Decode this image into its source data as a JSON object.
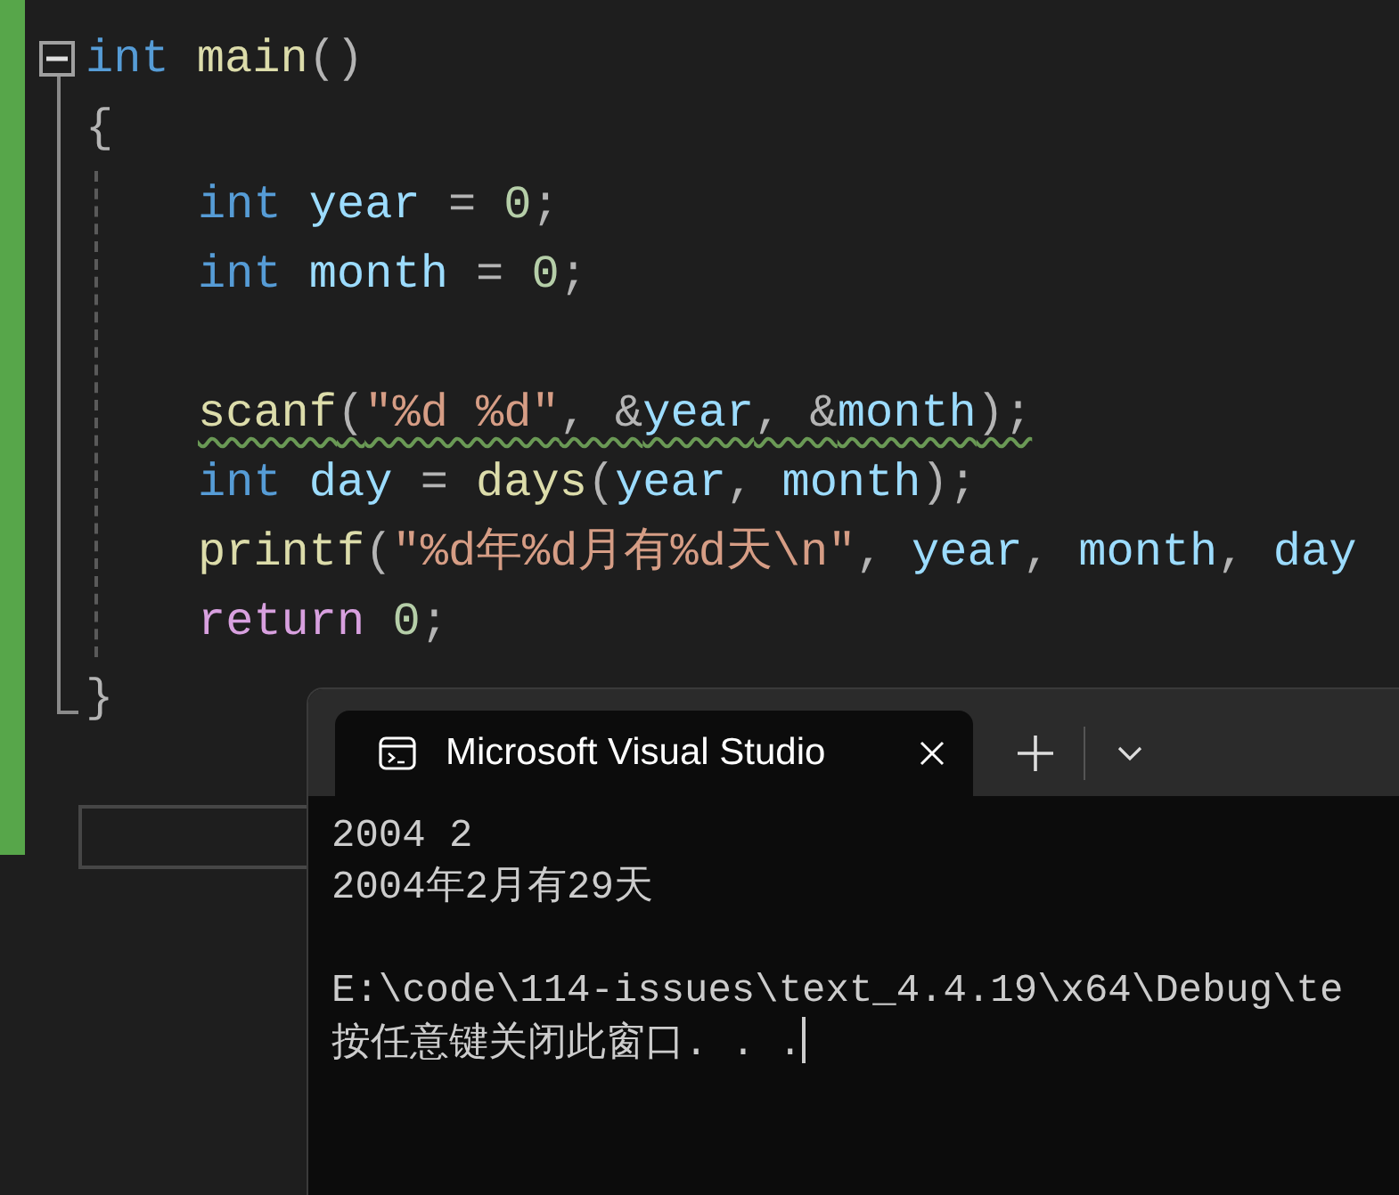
{
  "editor": {
    "lines": [
      {
        "tokens": [
          {
            "kind": "keyword",
            "text": "int"
          },
          {
            "kind": "function",
            "text": "main"
          },
          {
            "kind": "punct",
            "text": "()"
          }
        ]
      },
      {
        "tokens": [
          {
            "kind": "punct",
            "text": "{"
          }
        ],
        "children": [
          {
            "lines": [
              {
                "tokens": [
                  {
                    "kind": "keyword",
                    "text": "int"
                  },
                  {
                    "kind": "variable",
                    "text": "year"
                  },
                  {
                    "kind": "punct",
                    "text": "="
                  },
                  {
                    "kind": "number",
                    "text": "0"
                  },
                  {
                    "kind": "punct",
                    "text": ";"
                  }
                ],
                "warning": false
              },
              {
                "tokens": [
                  {
                    "kind": "keyword",
                    "text": "int"
                  },
                  {
                    "kind": "variable",
                    "text": "month"
                  },
                  {
                    "kind": "punct",
                    "text": "="
                  },
                  {
                    "kind": "number",
                    "text": "0"
                  },
                  {
                    "kind": "punct",
                    "text": ";"
                  }
                ],
                "warning": false
              }
            ]
          },
          {
            "lines": [
              {
                "tokens": [
                  {
                    "kind": "function",
                    "text": "scanf"
                  },
                  {
                    "kind": "punct",
                    "text": "("
                  },
                  {
                    "kind": "string",
                    "text": "\"%d %d\""
                  },
                  {
                    "kind": "punct",
                    "text": ", &"
                  },
                  {
                    "kind": "variable",
                    "text": "year"
                  },
                  {
                    "kind": "punct",
                    "text": ", &"
                  },
                  {
                    "kind": "variable",
                    "text": "month"
                  },
                  {
                    "kind": "punct",
                    "text": ");"
                  }
                ],
                "warning": true
              },
              {
                "tokens": [
                  {
                    "kind": "keyword",
                    "text": "int"
                  },
                  {
                    "kind": "variable",
                    "text": "day"
                  },
                  {
                    "kind": "punct",
                    "text": "="
                  },
                  {
                    "kind": "function",
                    "text": "days"
                  },
                  {
                    "kind": "punct",
                    "text": "("
                  },
                  {
                    "kind": "variable",
                    "text": "year"
                  },
                  {
                    "kind": "punct",
                    "text": ", "
                  },
                  {
                    "kind": "variable",
                    "text": "month"
                  },
                  {
                    "kind": "punct",
                    "text": ");"
                  }
                ],
                "warning": false
              },
              {
                "tokens": [
                  {
                    "kind": "function",
                    "text": "printf"
                  },
                  {
                    "kind": "punct",
                    "text": "("
                  },
                  {
                    "kind": "string",
                    "text": "\"%d年%d月有%d天\\n\""
                  },
                  {
                    "kind": "punct",
                    "text": ", "
                  },
                  {
                    "kind": "variable",
                    "text": "year"
                  },
                  {
                    "kind": "punct",
                    "text": ", "
                  },
                  {
                    "kind": "variable",
                    "text": "month"
                  },
                  {
                    "kind": "punct",
                    "text": ", "
                  },
                  {
                    "kind": "variable",
                    "text": "day"
                  }
                ],
                "warning": false
              },
              {
                "tokens": [
                  {
                    "kind": "control",
                    "text": "return"
                  },
                  {
                    "kind": "number",
                    "text": "0"
                  },
                  {
                    "kind": "punct",
                    "text": ";"
                  }
                ],
                "warning": false
              }
            ]
          }
        ]
      },
      {
        "tokens": [
          {
            "kind": "punct",
            "text": "}"
          }
        ]
      }
    ]
  },
  "terminal": {
    "tabs": [
      {
        "title": "Microsoft Visual Studio",
        "selected": true
      }
    ],
    "output_blocks": [
      [
        "2004 2",
        "2004年2月有29天"
      ],
      [
        "E:\\code\\114-issues\\text_4.4.19\\x64\\Debug\\te",
        "按任意键关闭此窗口. . ."
      ]
    ]
  }
}
